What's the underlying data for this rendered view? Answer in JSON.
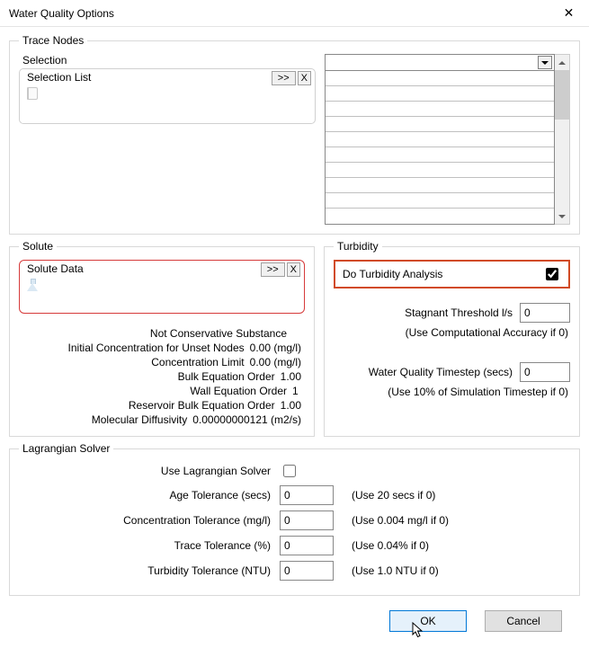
{
  "window": {
    "title": "Water Quality Options",
    "close_glyph": "✕"
  },
  "trace_nodes": {
    "legend": "Trace Nodes",
    "selection": {
      "label": "Selection",
      "selection_list": {
        "label": "Selection List",
        "expand_btn": ">>",
        "close_btn": "X"
      }
    },
    "grid_rows": 10
  },
  "solute": {
    "legend": "Solute",
    "solute_data": {
      "label": "Solute Data",
      "expand_btn": ">>",
      "close_btn": "X"
    },
    "properties": [
      {
        "label": "Not Conservative Substance",
        "value": ""
      },
      {
        "label": "Initial Concentration for Unset Nodes",
        "value": "0.00 (mg/l)"
      },
      {
        "label": "Concentration Limit",
        "value": "0.00 (mg/l)"
      },
      {
        "label": "Bulk Equation Order",
        "value": "1.00"
      },
      {
        "label": "Wall Equation Order",
        "value": "1"
      },
      {
        "label": "Reservoir Bulk Equation Order",
        "value": "1.00"
      },
      {
        "label": "Molecular Diffusivity",
        "value": "0.00000000121 (m2/s)"
      }
    ]
  },
  "turbidity": {
    "legend": "Turbidity",
    "do_analysis": {
      "label": "Do Turbidity Analysis",
      "checked": true
    },
    "stagnant_threshold": {
      "label": "Stagnant Threshold l/s",
      "value": "0",
      "note": "(Use Computational Accuracy if 0)"
    },
    "wq_timestep": {
      "label": "Water Quality Timestep (secs)",
      "value": "0",
      "note": "(Use 10% of Simulation Timestep if 0)"
    }
  },
  "lagrangian": {
    "legend": "Lagrangian Solver",
    "use_solver": {
      "label": "Use Lagrangian Solver",
      "checked": false
    },
    "rows": [
      {
        "label": "Age Tolerance (secs)",
        "value": "0",
        "hint": "(Use 20 secs if 0)"
      },
      {
        "label": "Concentration Tolerance (mg/l)",
        "value": "0",
        "hint": "(Use 0.004 mg/l if 0)"
      },
      {
        "label": "Trace Tolerance (%)",
        "value": "0",
        "hint": "(Use 0.04% if 0)"
      },
      {
        "label": "Turbidity Tolerance (NTU)",
        "value": "0",
        "hint": "(Use 1.0 NTU if 0)"
      }
    ]
  },
  "footer": {
    "ok": "OK",
    "cancel": "Cancel"
  }
}
